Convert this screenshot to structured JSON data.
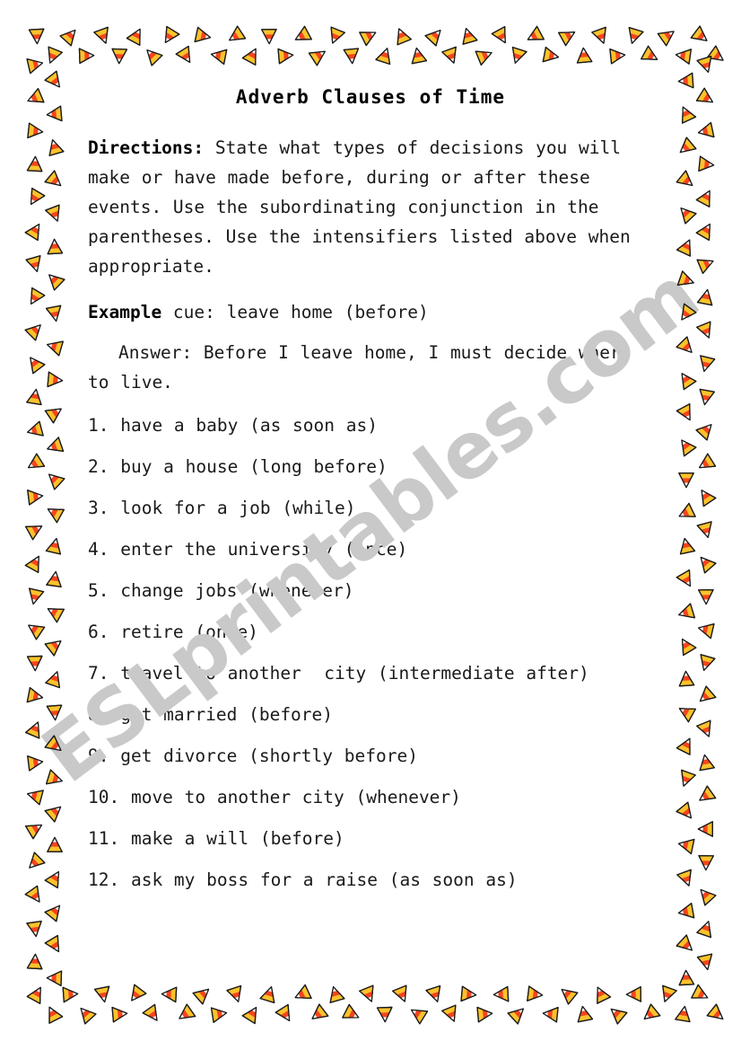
{
  "document": {
    "title": "Adverb Clauses of Time",
    "watermark": "ESLprintables.com",
    "border_theme": "candy-corn",
    "colors": {
      "candy_tip": "#ffffff",
      "candy_body": "#f4451c",
      "candy_base": "#fbc22b",
      "candy_outline": "#1a1a1a",
      "text": "#1a1a1a",
      "watermark": "#c9c9c9",
      "page_background": "#ffffff"
    }
  },
  "directions": {
    "lead": "Directions:",
    "body": " State what types of decisions you will make or have made before, during or after these events. Use the subordinating conjunction in the parentheses. Use the intensifiers listed above when appropriate."
  },
  "example": {
    "lead": "Example",
    "body": " cue: leave home (before)",
    "answer": "Answer: Before I leave home, I must decide where to live."
  },
  "items": [
    "1. have a baby (as soon as)",
    "2. buy a house (long before)",
    "3. look for a job (while)",
    "4. enter the university (once)",
    "5. change jobs (whenever)",
    "6. retire (once)",
    "7. travel to another  city (intermediate after)",
    "8. get married (before)",
    "9. get divorce (shortly before)",
    "10. move to another city (whenever)",
    "11. make a will (before)",
    "12. ask my boss for a raise (as soon as)"
  ]
}
